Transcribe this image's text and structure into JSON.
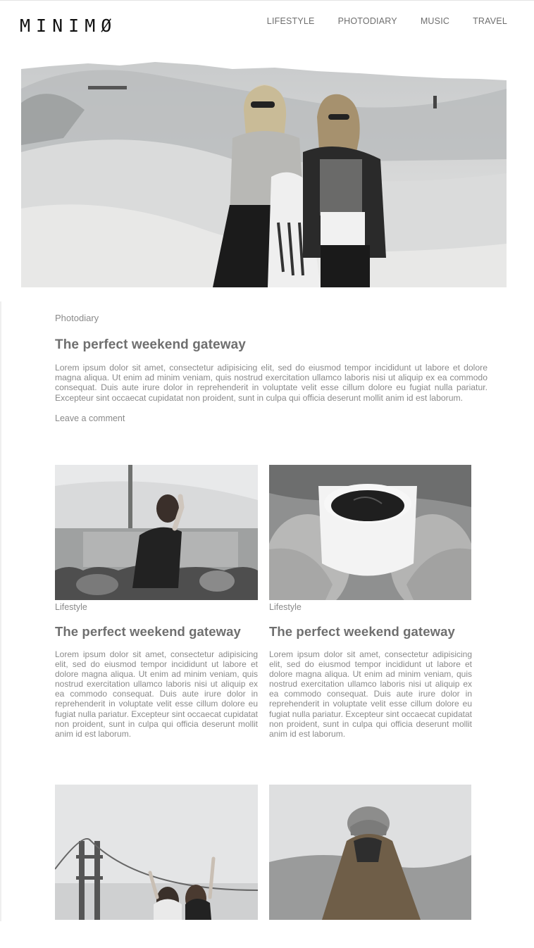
{
  "site": {
    "logo": "MINIMØ"
  },
  "nav": [
    {
      "label": "LIFESTYLE"
    },
    {
      "label": "PHOTODIARY"
    },
    {
      "label": "MUSIC"
    },
    {
      "label": "TRAVEL"
    }
  ],
  "featured": {
    "category": "Photodiary",
    "title": "The perfect weekend gateway",
    "excerpt": "Lorem ipsum dolor sit amet, consectetur adipisicing elit, sed do eiusmod tempor incididunt ut labore et dolore magna aliqua. Ut enim ad minim veniam, quis nostrud exercitation ullamco laboris nisi ut aliquip ex ea commodo consequat. Duis aute irure dolor in reprehenderit in voluptate velit esse cillum dolore eu fugiat nulla pariatur. Excepteur sint occaecat cupidatat non proident, sunt in culpa qui officia deserunt mollit anim id est laborum.",
    "comment_link": "Leave a comment"
  },
  "posts": [
    {
      "category": "Lifestyle",
      "title": "The perfect weekend gateway",
      "excerpt": "Lorem ipsum dolor sit amet, consectetur adipisicing elit, sed do eiusmod tempor incididunt ut labore et dolore magna aliqua. Ut enim ad minim veniam, quis nostrud exercitation ullamco laboris nisi ut aliquip ex ea commodo consequat. Duis aute irure dolor in reprehenderit in voluptate velit esse cillum dolore eu fugiat nulla pariatur. Excepteur sint occaecat cupidatat non proident, sunt in culpa qui officia deserunt mollit anim id est laborum."
    },
    {
      "category": "Lifestyle",
      "title": "The perfect weekend gateway",
      "excerpt": "Lorem ipsum dolor sit amet, consectetur adipisicing elit, sed do eiusmod tempor incididunt ut labore et dolore magna aliqua. Ut enim ad minim veniam, quis nostrud exercitation ullamco laboris nisi ut aliquip ex ea commodo consequat. Duis aute irure dolor in reprehenderit in voluptate velit esse cillum dolore eu fugiat nulla pariatur. Excepteur sint occaecat cupidatat non proident, sunt in culpa qui officia deserunt mollit anim id est laborum."
    }
  ],
  "colors": {
    "text": "#777777",
    "heading": "#6f6f6f",
    "logo": "#111111"
  }
}
